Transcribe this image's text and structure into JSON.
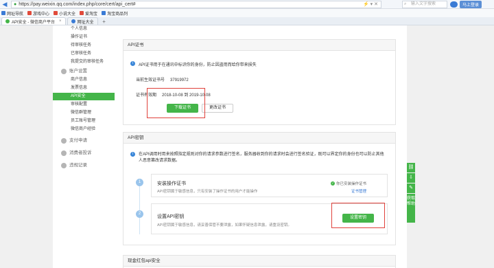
{
  "browser": {
    "url": "https://pay.weixin.qq.com/index.php/core/cert/api_cert#",
    "search_placeholder": "输入文字搜索",
    "login_label": "马上登录",
    "favorites": [
      {
        "label": "网址导航",
        "color": "#3a7bd5"
      },
      {
        "label": "游戏中心",
        "color": "#e04a3a"
      },
      {
        "label": "小说大全",
        "color": "#e04a3a"
      },
      {
        "label": "爱淘宝",
        "color": "#e04a3a"
      },
      {
        "label": "淘宝商品列",
        "color": "#3a7bd5"
      }
    ],
    "tabs": [
      {
        "label": "API安全 - 微信商户平台",
        "active": true
      },
      {
        "label": "网址大全",
        "active": false
      }
    ]
  },
  "sidebar": {
    "items_top": [
      "个人信息",
      "操作证书",
      "待审核任务",
      "已审核任务",
      "我提交的审核任务"
    ],
    "group_account": "账户设置",
    "items_account": [
      "商户信息",
      "发票信息",
      "API安全",
      "审核配置",
      "微信群管理",
      "员工账号管理",
      "微信商户经验"
    ],
    "active_item": "API安全",
    "group_pay": "支付申请",
    "group_complaint": "消费者投诉",
    "group_violation": "违规记录"
  },
  "cert_panel": {
    "title": "API证书",
    "notice": "API证书用于在通讯中标识你的身份，防止因盗用而给你带来损失",
    "current_label": "当前生效证书号",
    "current_value": "37919972",
    "validity_label": "证书有效期",
    "validity_value": "2018-10-08  到  2019-10-08",
    "download_button": "下载证书",
    "change_button": "更改证书"
  },
  "key_panel": {
    "title": "API密钥",
    "notice": "在API调用时用来按照指定规则对你的请求参数进行签名，服务器收到你的请求时会进行签名验证，既可以界定你的身份也可以防止其他人恶意篡改请求数据。",
    "step1": {
      "num": "1",
      "title": "安装操作证书",
      "desc": "API密钥属于敏感信息，只有安装了操作证书的用户才能操作",
      "status": "你已安装操作证书",
      "link": "证书管理"
    },
    "step2": {
      "num": "2",
      "title": "设置API密钥",
      "desc": "API密钥属于敏感信息，请妥善保管不要泄露，如果怀疑信息泄露，请重设密钥。",
      "button": "设置密钥"
    }
  },
  "red_packet_panel": {
    "title": "现金红包api安全"
  },
  "float_bar": {
    "help_label": "获取帮助"
  }
}
